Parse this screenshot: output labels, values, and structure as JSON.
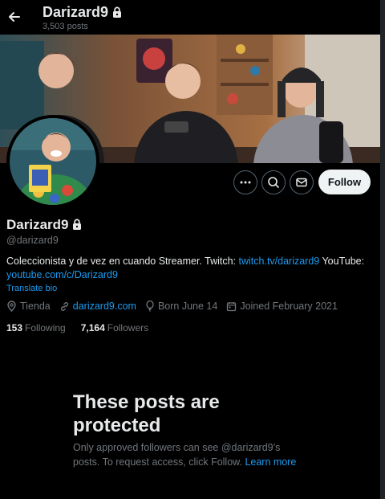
{
  "header": {
    "title": "Darizard9",
    "posts_count": "3,503 posts",
    "back_icon": "arrow-left-icon",
    "lock_icon": "lock-icon"
  },
  "profile": {
    "display_name": "Darizard9",
    "handle": "@darizard9",
    "bio_text": "Coleccionista y de vez en cuando Streamer.  Twitch: ",
    "bio_link1": "twitch.tv/darizard9",
    "bio_mid": "  YouTube: ",
    "bio_link2": "youtube.com/c/Darizard9",
    "translate": "Translate bio",
    "location": "Tienda",
    "website": "darizard9.com",
    "birthday": "Born June 14",
    "joined": "Joined February 2021",
    "following_count": "153",
    "following_label": "Following",
    "followers_count": "7,164",
    "followers_label": "Followers"
  },
  "actions": {
    "more_icon": "more-icon",
    "search_icon": "search-icon",
    "message_icon": "message-icon",
    "follow_label": "Follow"
  },
  "protected": {
    "title": "These posts are protected",
    "text": "Only approved followers can see @darizard9’s posts. To request access, click Follow. ",
    "link": "Learn more"
  },
  "colors": {
    "background": "#000000",
    "text": "#e7e9ea",
    "muted": "#71767b",
    "accent": "#1d9bf0",
    "follow_bg": "#eff3f4"
  }
}
